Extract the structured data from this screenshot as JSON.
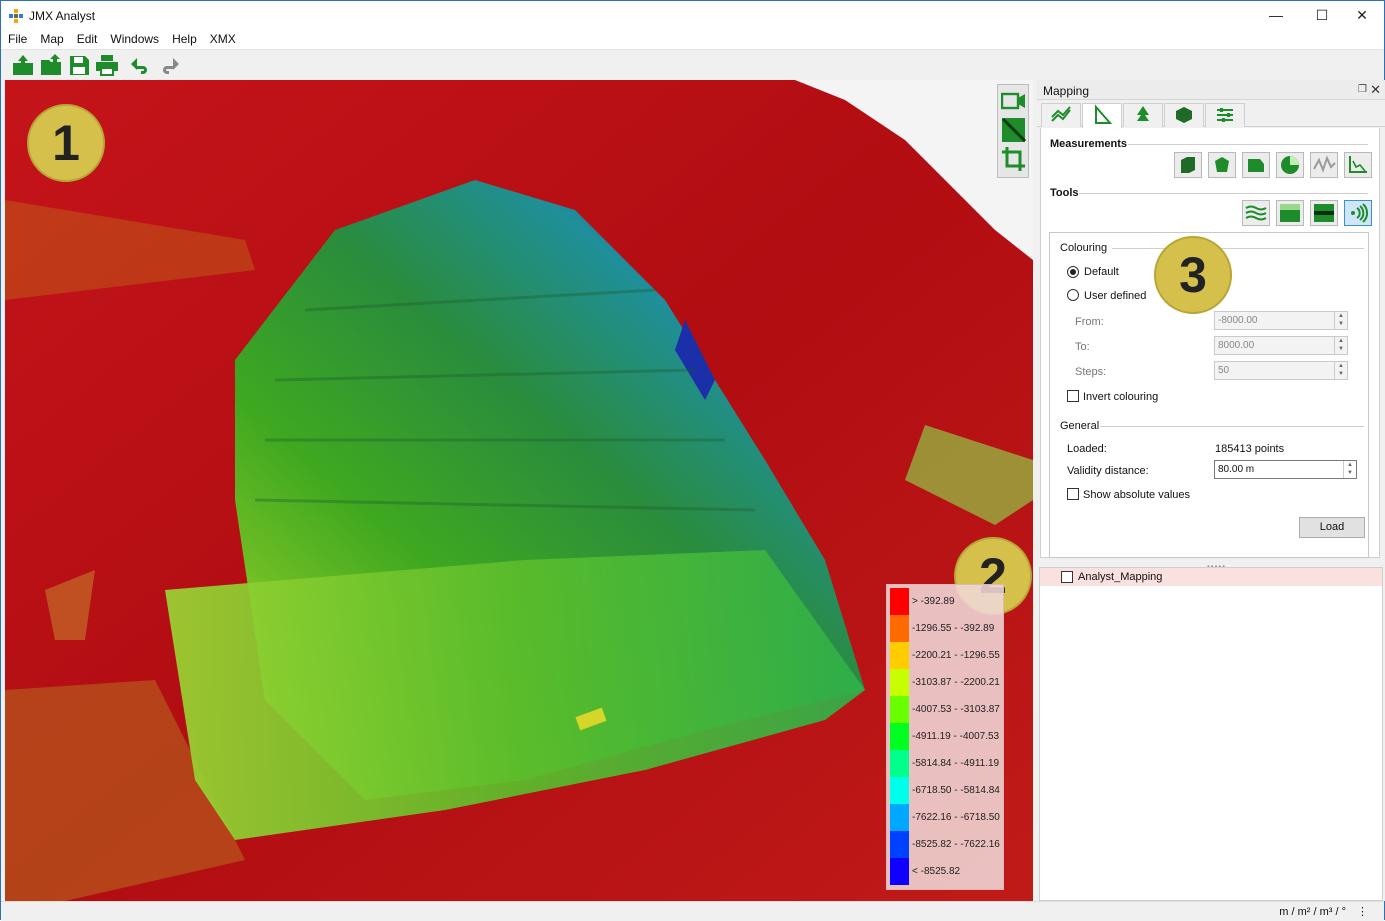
{
  "app": {
    "title": "JMX Analyst"
  },
  "window_controls": {
    "minimize": "—",
    "maximize": "☐",
    "close": "✕"
  },
  "menu": [
    "File",
    "Map",
    "Edit",
    "Windows",
    "Help",
    "XMX"
  ],
  "toolbar_icons": [
    "open-icon",
    "open-folder-icon",
    "save-icon",
    "print-icon",
    "undo-icon",
    "redo-icon"
  ],
  "viewport": {
    "badges": [
      "1",
      "2",
      "3"
    ],
    "view_tools": [
      "camera-icon",
      "plane-icon",
      "crop-icon"
    ]
  },
  "legend": {
    "rows": [
      {
        "label": "> -392.89",
        "color": "#ff0000"
      },
      {
        "label": "-1296.55 - -392.89",
        "color": "#ff6a00"
      },
      {
        "label": "-2200.21 - -1296.55",
        "color": "#ffcc00"
      },
      {
        "label": "-3103.87 - -2200.21",
        "color": "#c8ff00"
      },
      {
        "label": "-4007.53 - -3103.87",
        "color": "#6aff00"
      },
      {
        "label": "-4911.19 - -4007.53",
        "color": "#00ff20"
      },
      {
        "label": "-5814.84 - -4911.19",
        "color": "#00ff8a"
      },
      {
        "label": "-6718.50 - -5814.84",
        "color": "#00ffea"
      },
      {
        "label": "-7622.16 - -6718.50",
        "color": "#00a8ff"
      },
      {
        "label": "-8525.82 - -7622.16",
        "color": "#0040ff"
      },
      {
        "label": "< -8525.82",
        "color": "#1000ff"
      }
    ]
  },
  "panel": {
    "title": "Mapping",
    "tabs": [
      "profile-icon",
      "measure-icon",
      "tree-icon",
      "solid-icon",
      "sliders-icon"
    ],
    "measurements_label": "Measurements",
    "tools_label": "Tools",
    "colouring": {
      "title": "Colouring",
      "default_label": "Default",
      "user_defined_label": "User defined",
      "from_label": "From:",
      "from_value": "-8000.00",
      "to_label": "To:",
      "to_value": "8000.00",
      "steps_label": "Steps:",
      "steps_value": "50",
      "invert_label": "Invert colouring"
    },
    "general": {
      "title": "General",
      "loaded_label": "Loaded:",
      "loaded_value": "185413 points",
      "validity_label": "Validity distance:",
      "validity_value": "80.00 m",
      "absolute_label": "Show absolute values",
      "load_button": "Load"
    },
    "layers": [
      {
        "name": "Analyst_Mapping"
      }
    ]
  },
  "status": {
    "units": "m / m² / m³ / °"
  },
  "colors": {
    "accent": "#3b8fd1",
    "badge": "#d4c04a",
    "tool_green": "#1e8c2a"
  }
}
